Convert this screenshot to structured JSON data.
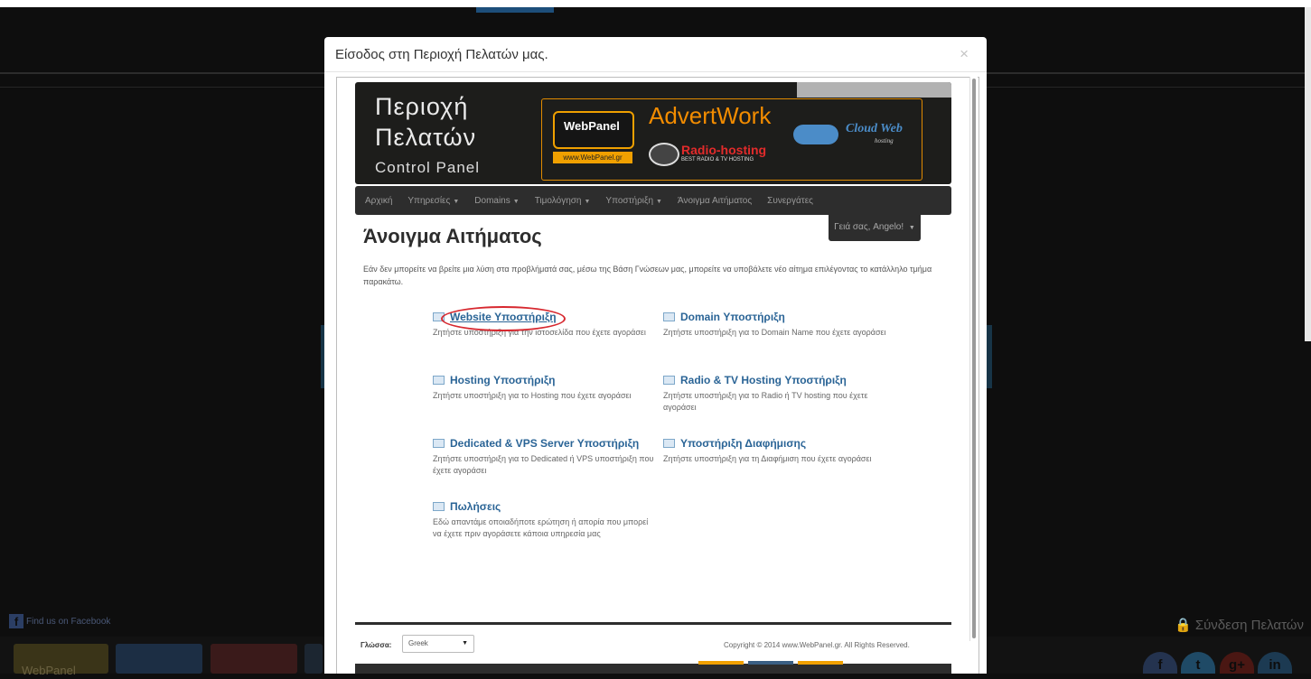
{
  "background": {
    "facebook_label": "Find us on Facebook",
    "login_label": "Σύνδεση Πελατών",
    "bottom_logo_label": "WebPanel",
    "social_icons": [
      "facebook-icon",
      "twitter-icon",
      "google-plus-icon",
      "linkedin-icon"
    ],
    "social_letters": [
      "f",
      "t",
      "g+",
      "in"
    ]
  },
  "modal": {
    "title": "Είσοδος στη Περιοχή Πελατών μας.",
    "close_label": "×"
  },
  "banner": {
    "line1": "Περιοχή",
    "line2": "Πελατών",
    "line3": "Control Panel",
    "ad_webpanel": "WebPanel",
    "ad_webpanel_url": "www.WebPanel.gr",
    "ad_advertwork": "AdvertWork",
    "ad_radio": "Radio-hosting",
    "ad_radio_sub": "BEST RADIO & TV HOSTING",
    "ad_cloud": "Cloud Web",
    "ad_cloud_sub": "hosting"
  },
  "nav": {
    "items": [
      {
        "label": "Αρχική",
        "dropdown": false
      },
      {
        "label": "Υπηρεσίες",
        "dropdown": true
      },
      {
        "label": "Domains",
        "dropdown": true
      },
      {
        "label": "Τιμολόγηση",
        "dropdown": true
      },
      {
        "label": "Υποστήριξη",
        "dropdown": true
      },
      {
        "label": "Άνοιγμα Αιτήματος",
        "dropdown": false
      },
      {
        "label": "Συνεργάτες",
        "dropdown": false
      }
    ],
    "greeting": "Γειά σας, Angelo!"
  },
  "page": {
    "title": "Άνοιγμα Αιτήματος",
    "intro": "Εάν δεν μπορείτε να βρείτε μια λύση στα προβλήματά σας, μέσω της Βάση Γνώσεων μας, μπορείτε να υποβάλετε νέο αίτημα επιλέγοντας το κατάλληλο τμήμα παρακάτω."
  },
  "departments": [
    {
      "name": "Website Υποστήριξη",
      "desc": "Ζητήστε υποστήριξη για την ιστοσελίδα που έχετε αγοράσει"
    },
    {
      "name": "Domain Υποστήριξη",
      "desc": "Ζητήστε υποστήριξη για το Domain Name που έχετε αγοράσει"
    },
    {
      "name": "Hosting Υποστήριξη",
      "desc": "Ζητήστε υποστήριξη για το Hosting που έχετε αγοράσει"
    },
    {
      "name": "Radio & TV Hosting Υποστήριξη",
      "desc": "Ζητήστε υποστήριξη για το Radio ή TV hosting που έχετε αγοράσει"
    },
    {
      "name": "Dedicated & VPS Server Υποστήριξη",
      "desc": "Ζητήστε υποστήριξη για το Dedicated ή VPS υποστήριξη που έχετε αγοράσει"
    },
    {
      "name": "Υποστήριξη Διαφήμισης",
      "desc": "Ζητήστε υποστήριξη για τη Διαφήμιση που έχετε αγοράσει"
    },
    {
      "name": "Πωλήσεις",
      "desc": "Εδώ απαντάμε οποιαδήποτε ερώτηση ή απορία που μπορεί να έχετε πριν αγοράσετε κάποια υπηρεσία μας"
    }
  ],
  "footer": {
    "language_label": "Γλώσσα:",
    "language_value": "Greek",
    "copyright": "Copyright © 2014 www.WebPanel.gr. All Rights Reserved."
  },
  "colors": {
    "link": "#2a6496",
    "highlight": "#d7282f",
    "accent": "#f28c00"
  }
}
